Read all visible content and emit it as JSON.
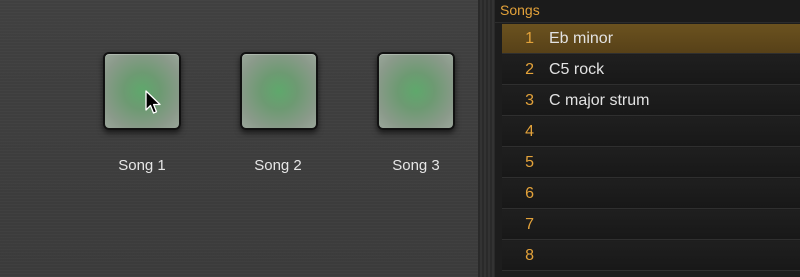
{
  "pads": [
    {
      "label": "Song 1"
    },
    {
      "label": "Song 2"
    },
    {
      "label": "Song 3"
    }
  ],
  "songs_panel": {
    "title": "Songs",
    "rows": [
      {
        "num": "1",
        "name": "Eb minor",
        "selected": true
      },
      {
        "num": "2",
        "name": "C5 rock",
        "selected": false
      },
      {
        "num": "3",
        "name": "C major strum",
        "selected": false
      },
      {
        "num": "4",
        "name": "",
        "selected": false
      },
      {
        "num": "5",
        "name": "",
        "selected": false
      },
      {
        "num": "6",
        "name": "",
        "selected": false
      },
      {
        "num": "7",
        "name": "",
        "selected": false
      },
      {
        "num": "8",
        "name": "",
        "selected": false
      }
    ]
  },
  "colors": {
    "accent": "#e3a23a",
    "selected_row": "#6b521f",
    "pad_glow": "#5fa86c"
  },
  "icons": {
    "cursor": "mouse-pointer-icon"
  }
}
